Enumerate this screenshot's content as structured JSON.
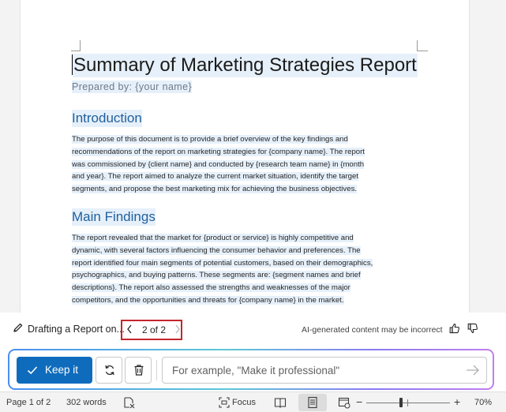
{
  "document": {
    "title": "Summary of Marketing Strategies Report",
    "subtitle": "Prepared by: {your name}",
    "sections": [
      {
        "heading": "Introduction",
        "lines": [
          "The purpose of this document is to provide a brief overview of the key findings and",
          "recommendations of the report on marketing strategies for {company name}. The report",
          "was commissioned by {client name} and conducted by {research team name} in {month",
          "and year}. The report aimed to analyze the current market situation, identify the target",
          "segments, and propose the best marketing mix for achieving the business objectives."
        ]
      },
      {
        "heading": "Main Findings",
        "lines": [
          "The report revealed that the market for {product or service} is highly competitive and",
          "dynamic, with several factors influencing the consumer behavior and preferences. The",
          "report identified four main segments of potential customers, based on their demographics,",
          "psychographics, and buying patterns. These segments are: {segment names and brief",
          "descriptions}. The report also assessed the strengths and weaknesses of the major",
          "competitors, and the opportunities and threats for {company name} in the market."
        ]
      }
    ]
  },
  "copilot": {
    "drafting_label": "Drafting a Report on...",
    "pager_text": "2 of 2",
    "ai_note": "AI-generated content may be incorrect",
    "keep_label": "Keep it",
    "prompt_placeholder": "For example, \"Make it professional\"",
    "accent_color": "#0f6cbd",
    "highlight_box_color": "#c4262e"
  },
  "status_bar": {
    "page": "Page 1 of 2",
    "words": "302 words",
    "focus": "Focus",
    "zoom": "70%"
  }
}
